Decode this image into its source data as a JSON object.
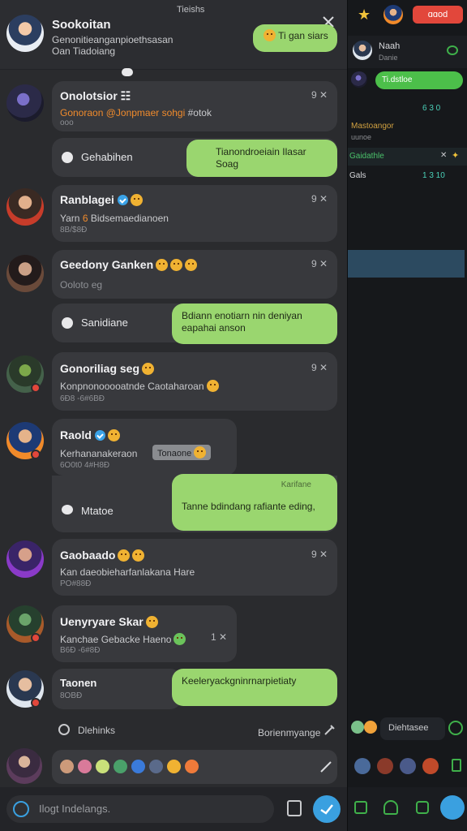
{
  "header": {
    "top_label": "Tieishs",
    "name": "Sookoitan",
    "line1": "Genonitieanganpioethsasan",
    "line2": "Oan Tiadoiang",
    "bubble": "Ti gan siars"
  },
  "chats": [
    {
      "name": "Onolotsior",
      "extra_icon": "☷",
      "time": "9",
      "preview": "Gonoraon @Jonpmaer sohgi",
      "preview_tail": "#otok",
      "meta": "ooo"
    },
    {
      "name": "Ranblagei",
      "time": "9",
      "preview": "Yarn",
      "preview_mid": "6",
      "preview_tail": "Bidsemaedianoen",
      "meta": "8B/$8Ð"
    },
    {
      "name": "Geedony Ganken",
      "time": "9",
      "preview": "Ooloto eg",
      "meta": ""
    },
    {
      "name": "Gonoriliag seg",
      "time": "9",
      "preview": "Konpnonooooatnde Caotaharoan",
      "meta": "6Ð8 -6#6BÐ"
    },
    {
      "name": "Raold",
      "time": "",
      "preview": "Kerhananakeraon",
      "preview_tag": "Tonaone",
      "meta": "6O0t0 4#H8Ð"
    },
    {
      "name": "Gaobaado",
      "time": "9",
      "preview": "Kan daeobieharfanlakana Hare",
      "meta": "PO#88Ð"
    },
    {
      "name": "Uenyryare Skar",
      "time": "1",
      "preview": "Kanchae Gebacke Haeno",
      "meta": "B6Ð -6#8Ð"
    },
    {
      "name": "Taonen",
      "time": "",
      "preview": "",
      "meta": "8OBÐ"
    }
  ],
  "actions": [
    {
      "label": "Gehabihen",
      "bubble": "Tianondroeiain Ilasar Soag"
    },
    {
      "label": "Sanidiane",
      "bubble": "Bdiann enotiarn nin deniyan eapahai anson"
    },
    {
      "label": "Mtatoe",
      "bubble_top": "Karifane",
      "bubble": "Tanne bdindang rafiante eding,"
    },
    {
      "label": "",
      "bubble": "Keeleryackgninrnarpietiaty"
    }
  ],
  "footer": {
    "left_label": "Dlehinks",
    "right_label": "Borienmyange",
    "input_placeholder": "Ilogt Indelangs."
  },
  "right_panel": {
    "top_button": "ɑɑod",
    "row1_name": "Naah",
    "row1_sub": "Danie",
    "bubble": "Ti.dstloe",
    "counts1": "6 3 0",
    "text2": "Mastoangor",
    "text2b": "uunoe",
    "label3": "Gaidathle",
    "label4": "Gals",
    "counts2": "1 3 10",
    "bottom_label": "Diehtasee"
  },
  "colors": {
    "accent_green": "#9ad66f",
    "accent_blue": "#3aa0e0",
    "accent_red": "#e2473b"
  }
}
